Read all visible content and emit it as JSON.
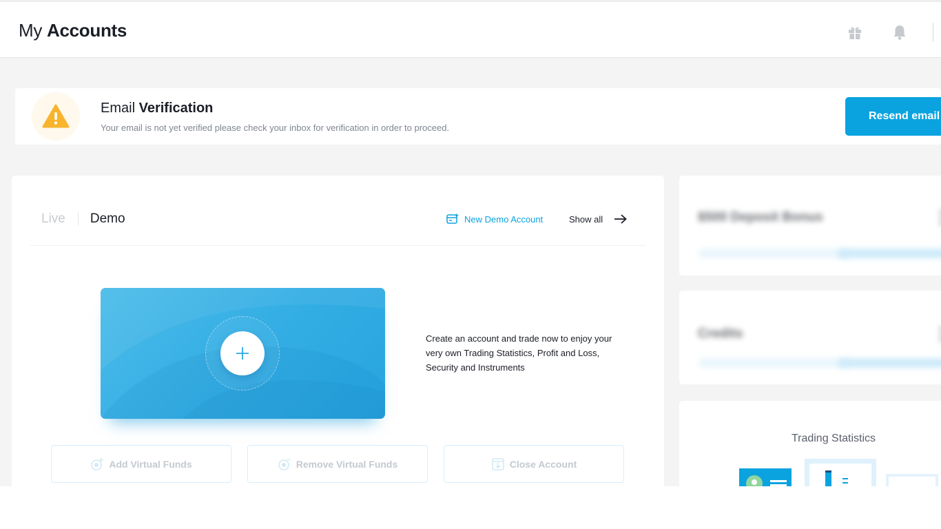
{
  "header": {
    "title_light": "My",
    "title_bold": "Accounts",
    "icons": [
      "gift-icon",
      "bell-icon"
    ]
  },
  "banner": {
    "title_light": "Email",
    "title_bold": "Verification",
    "message": "Your email is not yet verified please check your inbox for verification in order to proceed.",
    "button_label": "Resend email",
    "icon": "warning-icon"
  },
  "accounts": {
    "tabs": [
      {
        "label": "Live",
        "active": false
      },
      {
        "label": "Demo",
        "active": true
      }
    ],
    "new_demo_label": "New Demo Account",
    "show_all_label": "Show all",
    "create_text": "Create an account and trade now to enjoy your very own Trading Statistics, Profit and Loss, Security and Instruments",
    "actions": [
      {
        "label": "Add Virtual Funds",
        "icon": "add-funds-icon"
      },
      {
        "label": "Remove Virtual Funds",
        "icon": "remove-funds-icon"
      },
      {
        "label": "Close Account",
        "icon": "close-account-icon"
      }
    ]
  },
  "side": {
    "promo_title": "$500 Deposit Bonus",
    "credits_title": "Credits",
    "stats_title": "Trading Statistics"
  },
  "colors": {
    "accent": "#0aa3e0",
    "warning": "#f7b42c",
    "background": "#f4f4f4",
    "tile_blue": "#34aee4"
  }
}
